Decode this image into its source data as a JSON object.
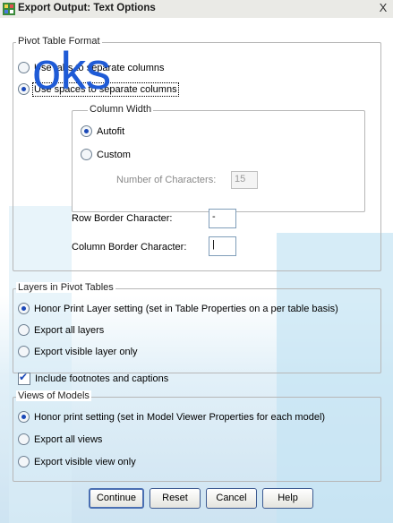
{
  "window": {
    "title": "Export Output: Text Options",
    "close_label": "X"
  },
  "watermark": "oks",
  "pivot_table_format": {
    "legend": "Pivot Table Format",
    "option_tabs": "Use tabs to separate columns",
    "option_spaces": "Use spaces to separate columns",
    "selected": "spaces",
    "column_width": {
      "legend": "Column Width",
      "autofit": "Autofit",
      "custom": "Custom",
      "selected": "autofit",
      "num_chars_label": "Number of Characters:",
      "num_chars_value": "15"
    },
    "row_border_label": "Row Border Character:",
    "row_border_value": "-",
    "column_border_label": "Column Border Character:",
    "column_border_value": "|"
  },
  "layers": {
    "legend": "Layers in Pivot Tables",
    "honor": "Honor Print Layer setting (set in Table Properties on a per table basis)",
    "all": "Export all layers",
    "visible": "Export visible layer only",
    "selected": "honor"
  },
  "footnotes": {
    "label": "Include footnotes and captions",
    "checked": true
  },
  "views": {
    "legend": "Views of Models",
    "honor": "Honor print setting (set in Model Viewer Properties for each model)",
    "all": "Export all views",
    "visible": "Export visible view only",
    "selected": "honor"
  },
  "buttons": {
    "continue": "Continue",
    "reset": "Reset",
    "cancel": "Cancel",
    "help": "Help"
  }
}
